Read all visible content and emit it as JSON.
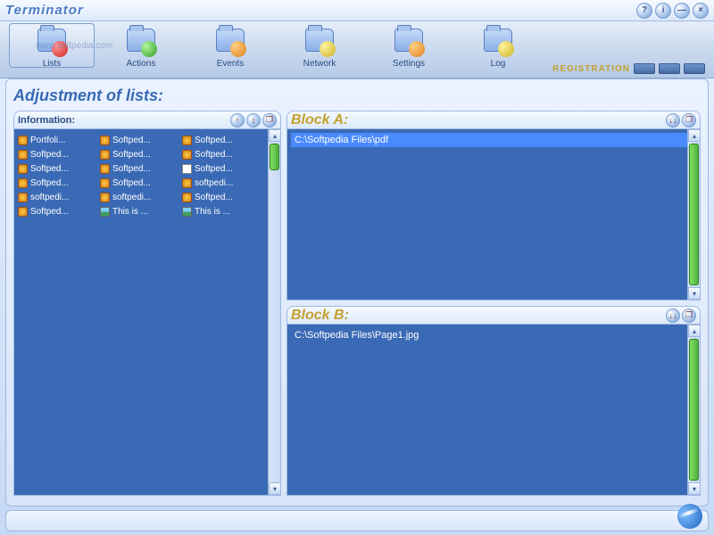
{
  "app": {
    "title": "Terminator",
    "watermark": "www.softpedia.com"
  },
  "window_controls": {
    "help": "?",
    "info": "i",
    "minimize": "—",
    "close": "×"
  },
  "toolbar": {
    "items": [
      {
        "label": "Lists",
        "badge": "red",
        "active": true
      },
      {
        "label": "Actions",
        "badge": "green"
      },
      {
        "label": "Events",
        "badge": "orange"
      },
      {
        "label": "Network",
        "badge": "yellow"
      },
      {
        "label": "Settings",
        "badge": "orange"
      },
      {
        "label": "Log",
        "badge": "yellow"
      }
    ],
    "registration": "REGISTRATION"
  },
  "main": {
    "title": "Adjustment of lists:",
    "info_panel": {
      "header": "Information:",
      "columns": [
        [
          {
            "icon": "lock",
            "t": "Portfoli..."
          },
          {
            "icon": "lock",
            "t": "Softped..."
          },
          {
            "icon": "lock",
            "t": "Softped..."
          },
          {
            "icon": "lock",
            "t": "Softped..."
          },
          {
            "icon": "lock",
            "t": "softpedi..."
          },
          {
            "icon": "lock",
            "t": "Softped..."
          }
        ],
        [
          {
            "icon": "lock",
            "t": "Softped..."
          },
          {
            "icon": "lock",
            "t": "Softped..."
          },
          {
            "icon": "lock",
            "t": "Softped..."
          },
          {
            "icon": "lock",
            "t": "Softped..."
          },
          {
            "icon": "lock",
            "t": "softpedi..."
          },
          {
            "icon": "img",
            "t": "This is ..."
          }
        ],
        [
          {
            "icon": "lock",
            "t": "Softped..."
          },
          {
            "icon": "lock",
            "t": "Softped..."
          },
          {
            "icon": "doc",
            "t": "Softped..."
          },
          {
            "icon": "lock",
            "t": "softpedi..."
          },
          {
            "icon": "lock",
            "t": "Softped..."
          },
          {
            "icon": "img",
            "t": "This is ..."
          }
        ]
      ]
    },
    "block_a": {
      "header": "Block  A:",
      "items": [
        {
          "t": "C:\\Softpedia Files\\pdf",
          "selected": true
        }
      ]
    },
    "block_b": {
      "header": "Block  B:",
      "items": [
        {
          "t": "C:\\Softpedia Files\\Page1.jpg",
          "selected": false
        }
      ]
    }
  }
}
